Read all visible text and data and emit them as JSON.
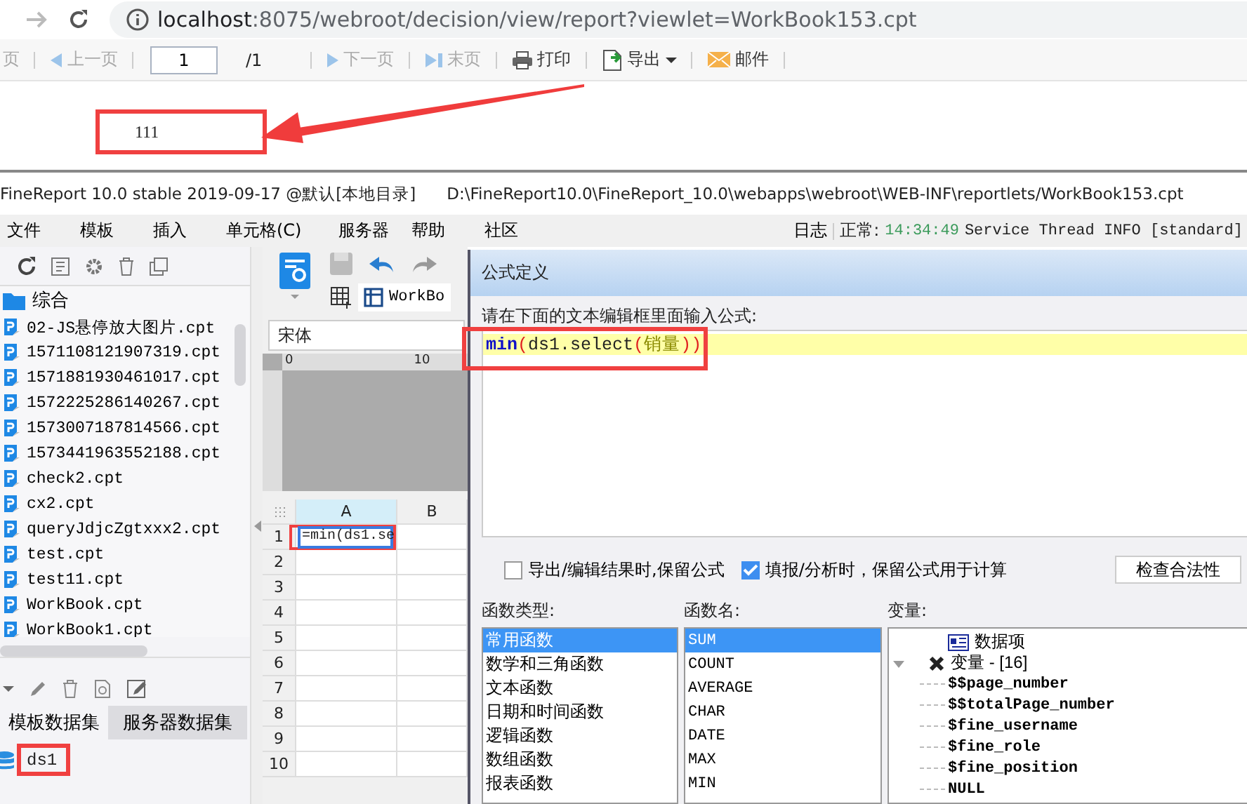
{
  "browser": {
    "url_host": "localhost",
    "url_path": ":8075/webroot/decision/view/report?viewlet=WorkBook153.cpt"
  },
  "report_toolbar": {
    "items": [
      {
        "kind": "button",
        "label": "页",
        "disabled": true
      },
      {
        "kind": "button",
        "label": "上一页",
        "disabled": true
      },
      {
        "kind": "page-input",
        "value": "1"
      },
      {
        "kind": "text",
        "label": "/1"
      },
      {
        "kind": "button",
        "label": "下一页",
        "disabled": true
      },
      {
        "kind": "button",
        "label": "末页",
        "disabled": true
      },
      {
        "kind": "button",
        "label": "打印",
        "disabled": false
      },
      {
        "kind": "menu",
        "label": "导出",
        "disabled": false
      },
      {
        "kind": "button",
        "label": "邮件",
        "disabled": false
      }
    ]
  },
  "report": {
    "cell": "111"
  },
  "designer": {
    "title": "FineReport 10.0 stable 2019-09-17 @默认[本地目录]",
    "path": "D:\\FineReport10.0\\FineReport_10.0\\webapps\\webroot\\WEB-INF\\reportlets/WorkBook153.cpt",
    "menus": [
      "文件",
      "模板",
      "插入",
      "单元格(C)",
      "服务器",
      "帮助",
      "社区"
    ],
    "log": "日志",
    "status_label": "正常:",
    "status_time": "14:34:49",
    "status_text": "Service Thread INFO [standard]"
  },
  "template_tree": {
    "root": "综合",
    "files": [
      "02-JS悬停放大图片.cpt",
      "1571108121907319.cpt",
      "1571881930461017.cpt",
      "1572225286140267.cpt",
      "1573007187814566.cpt",
      "1573441963552188.cpt",
      "check2.cpt",
      "cx2.cpt",
      "queryJdjcZgtxxx2.cpt",
      "test.cpt",
      "test11.cpt",
      "WorkBook.cpt",
      "WorkBook1.cpt"
    ]
  },
  "datasets": {
    "tabs": [
      {
        "label": "模板数据集",
        "selected": true
      },
      {
        "label": "服务器数据集",
        "selected": false
      }
    ],
    "items": [
      "ds1"
    ]
  },
  "editor": {
    "font": "宋体",
    "tab": "WorkBo",
    "ruler_marks": [
      "0",
      "10"
    ],
    "columns": [
      "A",
      "B"
    ],
    "rows": [
      "1",
      "2",
      "3",
      "4",
      "5",
      "6",
      "7",
      "8",
      "9",
      "10"
    ],
    "cell_a1": "=min(ds1.se"
  },
  "dialog": {
    "title": "公式定义",
    "prompt": "请在下面的文本编辑框里面输入公式:",
    "formula": [
      {
        "text": "min",
        "kind": "function"
      },
      {
        "text": "(",
        "kind": "paren"
      },
      {
        "text": "ds1.select",
        "kind": "plain"
      },
      {
        "text": "(",
        "kind": "paren"
      },
      {
        "text": "销量",
        "kind": "field"
      },
      {
        "text": "))",
        "kind": "paren"
      }
    ],
    "options": [
      {
        "label": "导出/编辑结果时,保留公式",
        "checked": false
      },
      {
        "label": "填报/分析时，保留公式用于计算",
        "checked": true
      }
    ],
    "check_button": "检查合法性",
    "function_types": {
      "heading": "函数类型:",
      "items": [
        {
          "label": "常用函数",
          "selected": true
        },
        {
          "label": "数学和三角函数",
          "selected": false
        },
        {
          "label": "文本函数",
          "selected": false
        },
        {
          "label": "日期和时间函数",
          "selected": false
        },
        {
          "label": "逻辑函数",
          "selected": false
        },
        {
          "label": "数组函数",
          "selected": false
        },
        {
          "label": "报表函数",
          "selected": false
        }
      ]
    },
    "function_names": {
      "heading": "函数名:",
      "items": [
        {
          "label": "SUM",
          "selected": true
        },
        {
          "label": "COUNT",
          "selected": false
        },
        {
          "label": "AVERAGE",
          "selected": false
        },
        {
          "label": "CHAR",
          "selected": false
        },
        {
          "label": "DATE",
          "selected": false
        },
        {
          "label": "MAX",
          "selected": false
        },
        {
          "label": "MIN",
          "selected": false
        }
      ]
    },
    "variables": {
      "heading": "变量:",
      "items": [
        {
          "label": "数据项",
          "kind": "dataset"
        },
        {
          "label": "变量 - [16]",
          "kind": "group",
          "expanded": true,
          "children": [
            {
              "label": "$$page_number"
            },
            {
              "label": "$$totalPage_number"
            },
            {
              "label": "$fine_username"
            },
            {
              "label": "$fine_role"
            },
            {
              "label": "$fine_position"
            },
            {
              "label": "NULL"
            }
          ]
        }
      ]
    }
  }
}
